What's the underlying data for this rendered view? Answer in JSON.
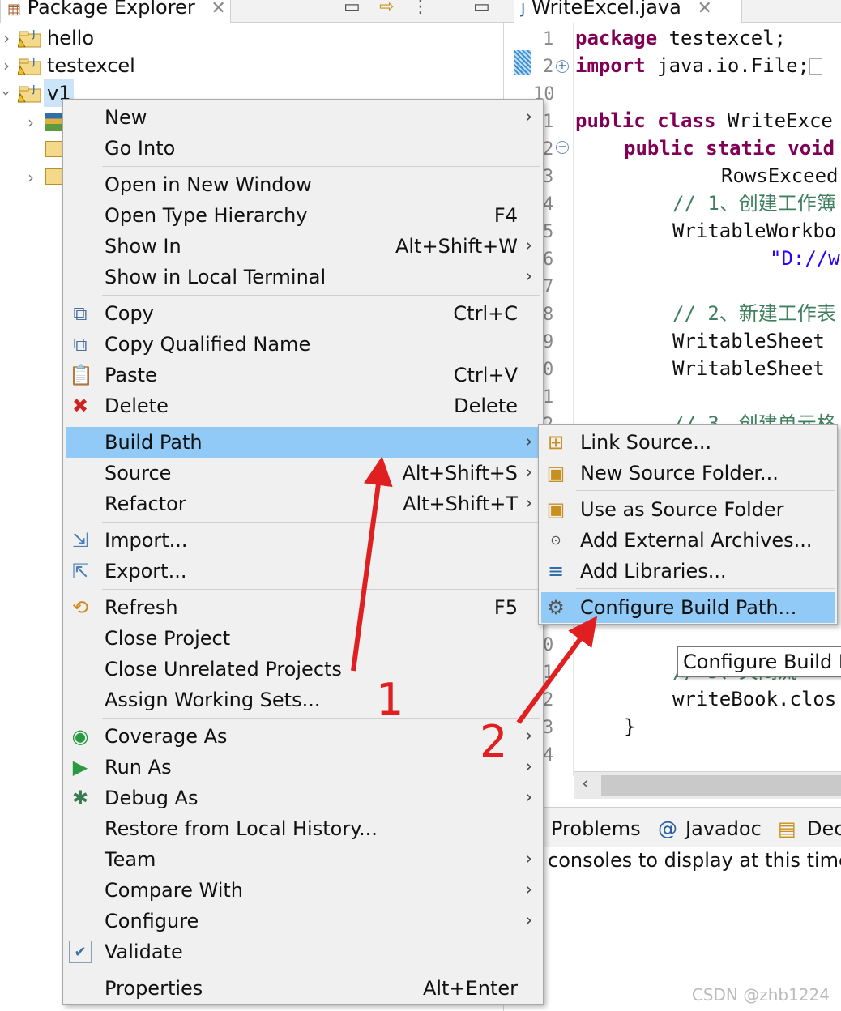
{
  "package_explorer": {
    "tab_title": "Package Explorer",
    "projects": [
      {
        "name": "hello",
        "expanded": false
      },
      {
        "name": "testexcel",
        "expanded": false
      },
      {
        "name": "v1",
        "expanded": true,
        "selected": true
      }
    ]
  },
  "editor": {
    "tab_title": "WriteExcel.java",
    "line_numbers": [
      "1",
      "2",
      "10",
      "1",
      "2",
      "3",
      "4",
      "5",
      "6",
      "7",
      "8",
      "9",
      "0",
      "1",
      "2"
    ],
    "lower_line_numbers": [
      "0",
      "1",
      "2",
      "3",
      "4"
    ],
    "lines": {
      "l1_kw": "package",
      "l1_rest": " testexcel;",
      "l2_kw": "import",
      "l2_rest": " java.io.File;",
      "l4_kw": "public class",
      "l4_rest": " WriteExce",
      "l5_kw": "public static void",
      "l6_rest": "RowsExceed",
      "l7_comment": "// 1、创建工作簿",
      "l8_rest": "WritableWorkbo",
      "l9_str": "\"D://w",
      "l11_comment": "// 2、新建工作表",
      "l12_rest": "WritableSheet",
      "l13_rest": "WritableSheet",
      "l15_comment": "// 3、创建单元格",
      "l_close_comment": "// 5、关闭流",
      "l_close_code": "writeBook.clos",
      "l_brace": "}"
    }
  },
  "bottom_panel": {
    "tabs": [
      "Problems",
      "Javadoc",
      "Dec"
    ],
    "message": "consoles to display at this time."
  },
  "tooltip": "Configure Build P",
  "context_menu": {
    "groups": [
      [
        {
          "label": "New",
          "arrow": true
        },
        {
          "label": "Go Into"
        }
      ],
      [
        {
          "label": "Open in New Window"
        },
        {
          "label": "Open Type Hierarchy",
          "shortcut": "F4"
        },
        {
          "label": "Show In",
          "shortcut": "Alt+Shift+W",
          "arrow": true
        },
        {
          "label": "Show in Local Terminal",
          "arrow": true
        }
      ],
      [
        {
          "label": "Copy",
          "shortcut": "Ctrl+C",
          "icon": "copy-icon"
        },
        {
          "label": "Copy Qualified Name",
          "icon": "copy-qualified-icon"
        },
        {
          "label": "Paste",
          "shortcut": "Ctrl+V",
          "icon": "paste-icon"
        },
        {
          "label": "Delete",
          "shortcut": "Delete",
          "icon": "delete-icon"
        }
      ],
      [
        {
          "label": "Build Path",
          "arrow": true,
          "selected": true
        },
        {
          "label": "Source",
          "shortcut": "Alt+Shift+S",
          "arrow": true
        },
        {
          "label": "Refactor",
          "shortcut": "Alt+Shift+T",
          "arrow": true
        }
      ],
      [
        {
          "label": "Import...",
          "icon": "import-icon"
        },
        {
          "label": "Export...",
          "icon": "export-icon"
        }
      ],
      [
        {
          "label": "Refresh",
          "shortcut": "F5",
          "icon": "refresh-icon"
        },
        {
          "label": "Close Project"
        },
        {
          "label": "Close Unrelated Projects"
        },
        {
          "label": "Assign Working Sets..."
        }
      ],
      [
        {
          "label": "Coverage As",
          "arrow": true,
          "icon": "coverage-icon"
        },
        {
          "label": "Run As",
          "arrow": true,
          "icon": "run-icon"
        },
        {
          "label": "Debug As",
          "arrow": true,
          "icon": "debug-icon"
        },
        {
          "label": "Restore from Local History..."
        },
        {
          "label": "Team",
          "arrow": true
        },
        {
          "label": "Compare With",
          "arrow": true
        },
        {
          "label": "Configure",
          "arrow": true
        },
        {
          "label": "Validate",
          "icon": "validate-icon"
        }
      ],
      [
        {
          "label": "Properties",
          "shortcut": "Alt+Enter"
        }
      ]
    ]
  },
  "build_path_submenu": {
    "items": [
      {
        "label": "Link Source...",
        "icon": "link-source-icon"
      },
      {
        "label": "New Source Folder...",
        "icon": "new-source-folder-icon"
      },
      {
        "label": "Use as Source Folder",
        "icon": "use-source-folder-icon"
      },
      {
        "label": "Add External Archives...",
        "icon": "external-archive-icon"
      },
      {
        "label": "Add Libraries...",
        "icon": "libraries-icon"
      },
      {
        "label": "Configure Build Path...",
        "icon": "configure-build-path-icon",
        "selected": true
      }
    ]
  },
  "annotations": {
    "step1": "1",
    "step2": "2"
  },
  "colors": {
    "selection": "#91c9f7",
    "menu_bg": "#f0f0f0",
    "arrow": "#e02020",
    "keyword": "#7f0055",
    "comment": "#3f7f5f",
    "string": "#2a00ff"
  },
  "watermark": "CSDN @zhb1224"
}
